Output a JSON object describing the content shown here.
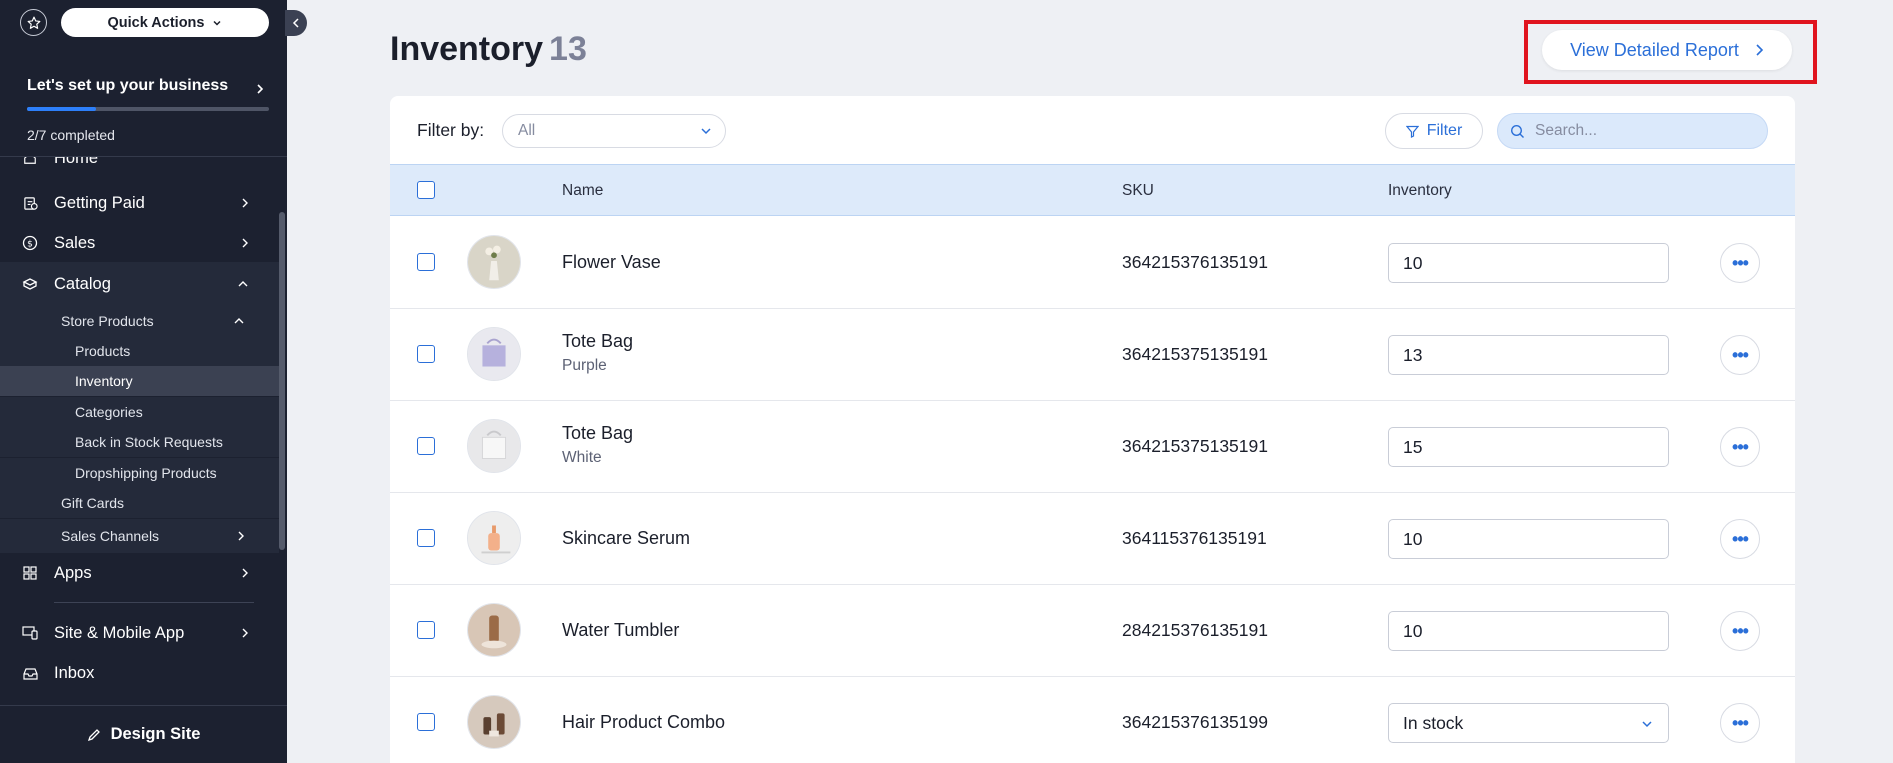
{
  "sidebar": {
    "quick_actions": "Quick Actions",
    "setup": {
      "title": "Let's set up your business",
      "progress_text": "2/7 completed",
      "progress_fraction": 0.2857
    },
    "items": [
      {
        "label": "Home",
        "icon": "home-icon"
      },
      {
        "label": "Getting Paid",
        "icon": "invoice-icon"
      },
      {
        "label": "Sales",
        "icon": "dollar-circle-icon"
      },
      {
        "label": "Catalog",
        "icon": "catalog-icon"
      },
      {
        "label": "Apps",
        "icon": "apps-grid-icon"
      },
      {
        "label": "Site & Mobile App",
        "icon": "devices-icon"
      },
      {
        "label": "Inbox",
        "icon": "inbox-icon"
      }
    ],
    "catalog_sub": {
      "store_products": "Store Products",
      "products": "Products",
      "inventory": "Inventory",
      "categories": "Categories",
      "back_in_stock": "Back in Stock Requests",
      "dropshipping": "Dropshipping Products",
      "gift_cards": "Gift Cards",
      "sales_channels": "Sales Channels"
    },
    "design_site": "Design Site"
  },
  "header": {
    "title": "Inventory",
    "count": "13",
    "report_button": "View Detailed Report"
  },
  "toolbar": {
    "filter_by_label": "Filter by:",
    "filter_value": "All",
    "filter_button": "Filter",
    "search_placeholder": "Search..."
  },
  "table": {
    "columns": {
      "name": "Name",
      "sku": "SKU",
      "inventory": "Inventory"
    },
    "rows": [
      {
        "name": "Flower Vase",
        "variant": "",
        "sku": "364215376135191",
        "inventory": "10",
        "type": "input",
        "thumb": "vase"
      },
      {
        "name": "Tote Bag",
        "variant": "Purple",
        "sku": "364215375135191",
        "inventory": "13",
        "type": "input",
        "thumb": "bag-purple"
      },
      {
        "name": "Tote Bag",
        "variant": "White",
        "sku": "364215375135191",
        "inventory": "15",
        "type": "input",
        "thumb": "bag-white"
      },
      {
        "name": "Skincare Serum",
        "variant": "",
        "sku": "364115376135191",
        "inventory": "10",
        "type": "input",
        "thumb": "serum"
      },
      {
        "name": "Water Tumbler",
        "variant": "",
        "sku": "284215376135191",
        "inventory": "10",
        "type": "input",
        "thumb": "tumbler"
      },
      {
        "name": "Hair Product Combo",
        "variant": "",
        "sku": "364215376135199",
        "inventory": "In stock",
        "type": "select",
        "thumb": "hair"
      }
    ]
  },
  "colors": {
    "sidebar_bg": "#1c2130",
    "accent": "#2b6fd8",
    "highlight_border": "#e0141e",
    "table_header_bg": "#ddeafa"
  }
}
